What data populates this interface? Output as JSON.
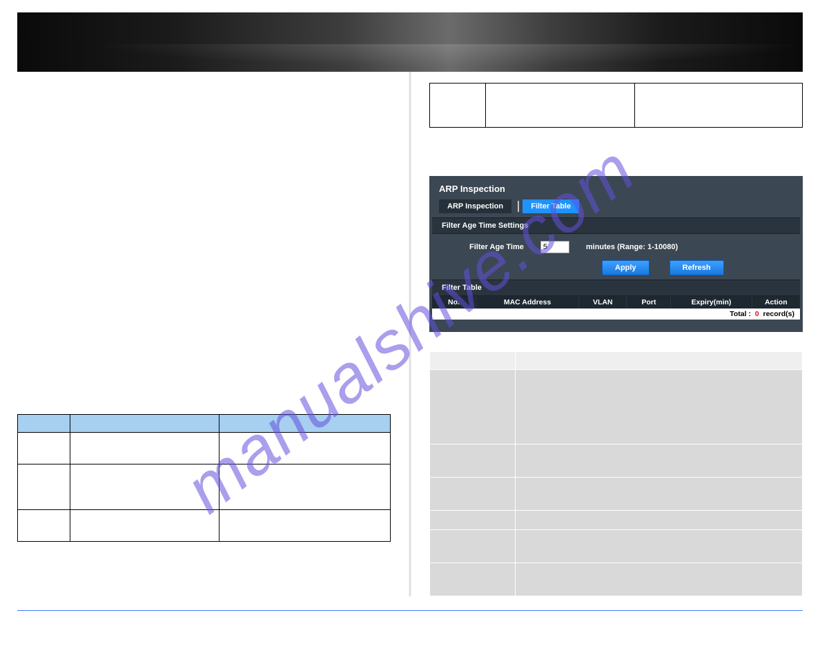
{
  "watermark": "manualshive.com",
  "arp": {
    "title": "ARP Inspection",
    "tabs": {
      "inspection": "ARP Inspection",
      "filter": "Filter Table"
    },
    "section_age": "Filter Age Time Settings",
    "age_label": "Filter Age Time",
    "age_value": "5",
    "age_hint": "minutes (Range: 1-10080)",
    "btn_apply": "Apply",
    "btn_refresh": "Refresh",
    "section_table": "Filter Table",
    "cols": {
      "no": "No.",
      "mac": "MAC Address",
      "vlan": "VLAN",
      "port": "Port",
      "expiry": "Expiry(min)",
      "action": "Action"
    },
    "total_prefix": "Total :",
    "total_value": "0",
    "total_suffix": "record(s)"
  }
}
